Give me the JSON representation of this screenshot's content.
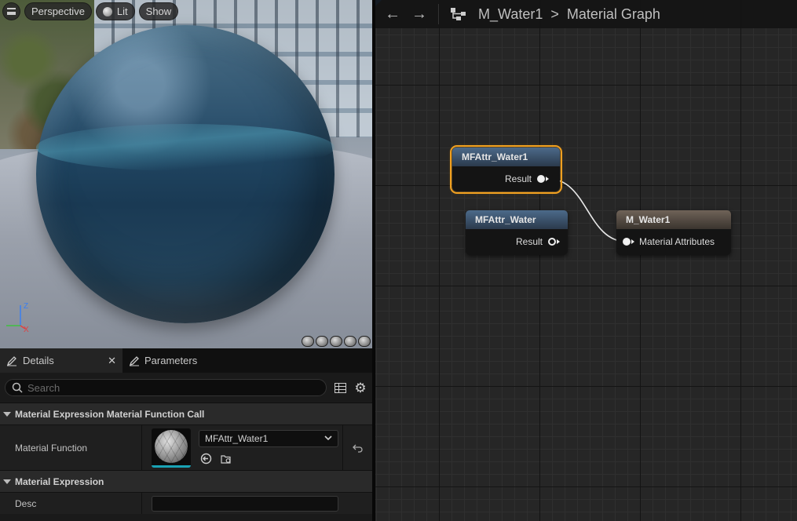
{
  "viewport": {
    "menu_icon": "hamburger-icon",
    "perspective_label": "Perspective",
    "lit_label": "Lit",
    "show_label": "Show",
    "axis_z": "Z",
    "axis_x": "X",
    "preview_shapes": [
      "cylinder-icon",
      "sphere-icon",
      "plane-icon",
      "cube-icon",
      "custom-mesh-icon"
    ]
  },
  "details": {
    "tab_details": "Details",
    "tab_parameters": "Parameters",
    "search_placeholder": "Search",
    "section1_title": "Material Expression Material Function Call",
    "material_function_label": "Material Function",
    "material_function_value": "MFAttr_Water1",
    "section2_title": "Material Expression",
    "desc_label": "Desc",
    "desc_value": ""
  },
  "graph": {
    "breadcrumb_asset": "M_Water1",
    "breadcrumb_separator": ">",
    "breadcrumb_graph": "Material Graph",
    "nodes": [
      {
        "title": "MFAttr_Water1",
        "pin": "Result",
        "selected": true
      },
      {
        "title": "MFAttr_Water",
        "pin": "Result",
        "selected": false
      },
      {
        "title": "M_Water1",
        "pin": "Material Attributes",
        "selected": false
      }
    ]
  },
  "colors": {
    "selection": "#f0a020",
    "accent_blue": "#1e6fd0",
    "thumb_underline": "#1aa3b5"
  }
}
